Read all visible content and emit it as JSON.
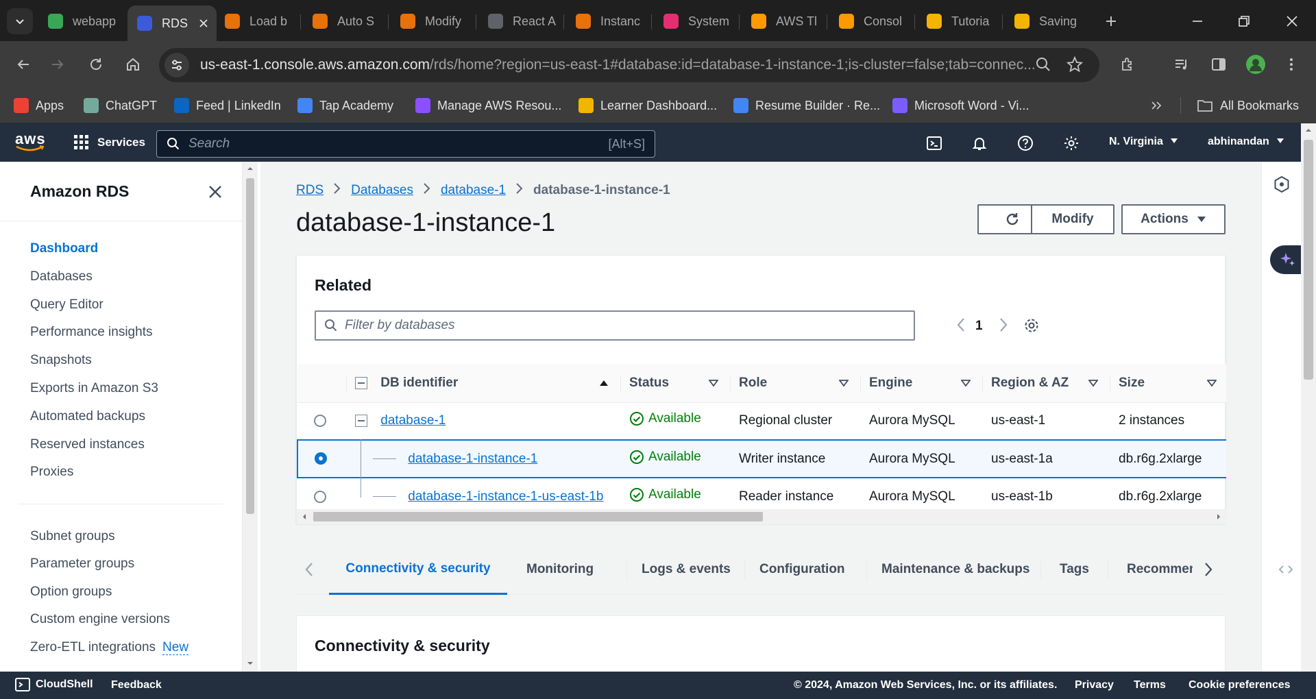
{
  "browser": {
    "tabs": [
      {
        "label": "webapp",
        "color": "#3aa757",
        "active": false
      },
      {
        "label": "RDS",
        "color": "#3b5bdb",
        "active": true
      },
      {
        "label": "Load b",
        "color": "#e8710a",
        "active": false
      },
      {
        "label": "Auto S",
        "color": "#e8710a",
        "active": false
      },
      {
        "label": "Modify",
        "color": "#e8710a",
        "active": false
      },
      {
        "label": "React A",
        "color": "#5f6368",
        "active": false
      },
      {
        "label": "Instanc",
        "color": "#e8710a",
        "active": false
      },
      {
        "label": "System",
        "color": "#e52e71",
        "active": false
      },
      {
        "label": "AWS Tl",
        "color": "#ff9900",
        "active": false
      },
      {
        "label": "Consol",
        "color": "#ff9900",
        "active": false
      },
      {
        "label": "Tutoria",
        "color": "#f4b400",
        "active": false
      },
      {
        "label": "Saving",
        "color": "#f4b400",
        "active": false
      }
    ],
    "url_host": "us-east-1.console.aws.amazon.com",
    "url_path": "/rds/home?region=us-east-1#database:id=database-1-instance-1;is-cluster=false;tab=connec...",
    "bookmarks": [
      {
        "label": "Apps",
        "color": "#ea4335"
      },
      {
        "label": "ChatGPT",
        "color": "#74aa9c"
      },
      {
        "label": "Feed | LinkedIn",
        "color": "#0a66c2"
      },
      {
        "label": "Tap Academy",
        "color": "#4285f4"
      },
      {
        "label": "Manage AWS Resou...",
        "color": "#8c4fff"
      },
      {
        "label": "Learner Dashboard...",
        "color": "#f4b400"
      },
      {
        "label": "Resume Builder · Re...",
        "color": "#4285f4"
      },
      {
        "label": "Microsoft Word - Vi...",
        "color": "#7b5cff"
      }
    ],
    "all_bookmarks": "All Bookmarks"
  },
  "aws_nav": {
    "logo": "aws",
    "services": "Services",
    "search_placeholder": "Search",
    "search_shortcut": "[Alt+S]",
    "region": "N. Virginia",
    "user": "abhinandan"
  },
  "sidenav": {
    "title": "Amazon RDS",
    "items": [
      "Dashboard",
      "Databases",
      "Query Editor",
      "Performance insights",
      "Snapshots",
      "Exports in Amazon S3",
      "Automated backups",
      "Reserved instances",
      "Proxies"
    ],
    "items2": [
      "Subnet groups",
      "Parameter groups",
      "Option groups",
      "Custom engine versions",
      "Zero-ETL integrations"
    ],
    "new_badge": "New"
  },
  "breadcrumb": [
    "RDS",
    "Databases",
    "database-1",
    "database-1-instance-1"
  ],
  "page_title": "database-1-instance-1",
  "buttons": {
    "modify": "Modify",
    "actions": "Actions"
  },
  "related": {
    "heading": "Related",
    "filter_placeholder": "Filter by databases",
    "page": "1",
    "columns": [
      "DB identifier",
      "Status",
      "Role",
      "Engine",
      "Region & AZ",
      "Size"
    ],
    "rows": [
      {
        "id": "database-1",
        "status": "Available",
        "role": "Regional cluster",
        "engine": "Aurora MySQL",
        "region": "us-east-1",
        "size": "2 instances"
      },
      {
        "id": "database-1-instance-1",
        "status": "Available",
        "role": "Writer instance",
        "engine": "Aurora MySQL",
        "region": "us-east-1a",
        "size": "db.r6g.2xlarge"
      },
      {
        "id": "database-1-instance-1-us-east-1b",
        "status": "Available",
        "role": "Reader instance",
        "engine": "Aurora MySQL",
        "region": "us-east-1b",
        "size": "db.r6g.2xlarge"
      }
    ]
  },
  "detail_tabs": [
    "Connectivity & security",
    "Monitoring",
    "Logs & events",
    "Configuration",
    "Maintenance & backups",
    "Tags",
    "Recommen"
  ],
  "section_heading": "Connectivity & security",
  "footer": {
    "cloudshell": "CloudShell",
    "feedback": "Feedback",
    "copyright": "© 2024, Amazon Web Services, Inc. or its affiliates.",
    "privacy": "Privacy",
    "terms": "Terms",
    "cookies": "Cookie preferences"
  },
  "colors": {
    "aws_navy": "#232f3e",
    "link_blue": "#0972d3",
    "success_green": "#037f0c",
    "aws_orange": "#ff9900"
  }
}
